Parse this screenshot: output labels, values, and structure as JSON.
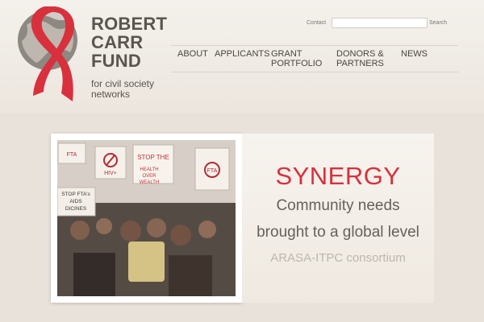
{
  "brand": {
    "name_lines": [
      "ROBERT",
      "CARR",
      "FUND"
    ],
    "tagline_lines": [
      "for civil society",
      "networks"
    ],
    "logo_icon": "globe-with-red-ribbon-icon"
  },
  "top_bar": {
    "contact_label": "Contact",
    "search_value": "",
    "search_placeholder": "",
    "search_button_label": "Search"
  },
  "nav": {
    "items": [
      {
        "label": "ABOUT"
      },
      {
        "label": "APPLICANTS"
      },
      {
        "label": "GRANT PORTFOLIO"
      },
      {
        "label": "DONORS & PARTNERS"
      },
      {
        "label": "NEWS"
      }
    ]
  },
  "feature": {
    "title": "SYNERGY",
    "line1": "Community needs",
    "line2": "brought to a global level",
    "source": "ARASA-ITPC consortium",
    "image_signs": [
      "STOP THE",
      "HIV+",
      "FTA",
      "STOP FTA's",
      "AIDS",
      "DICINES",
      "HEALTH",
      "OVER",
      "WEALTH",
      "FTA"
    ]
  },
  "colors": {
    "accent": "#d8313d",
    "text": "#5a554f",
    "background": "#e8e2da"
  }
}
